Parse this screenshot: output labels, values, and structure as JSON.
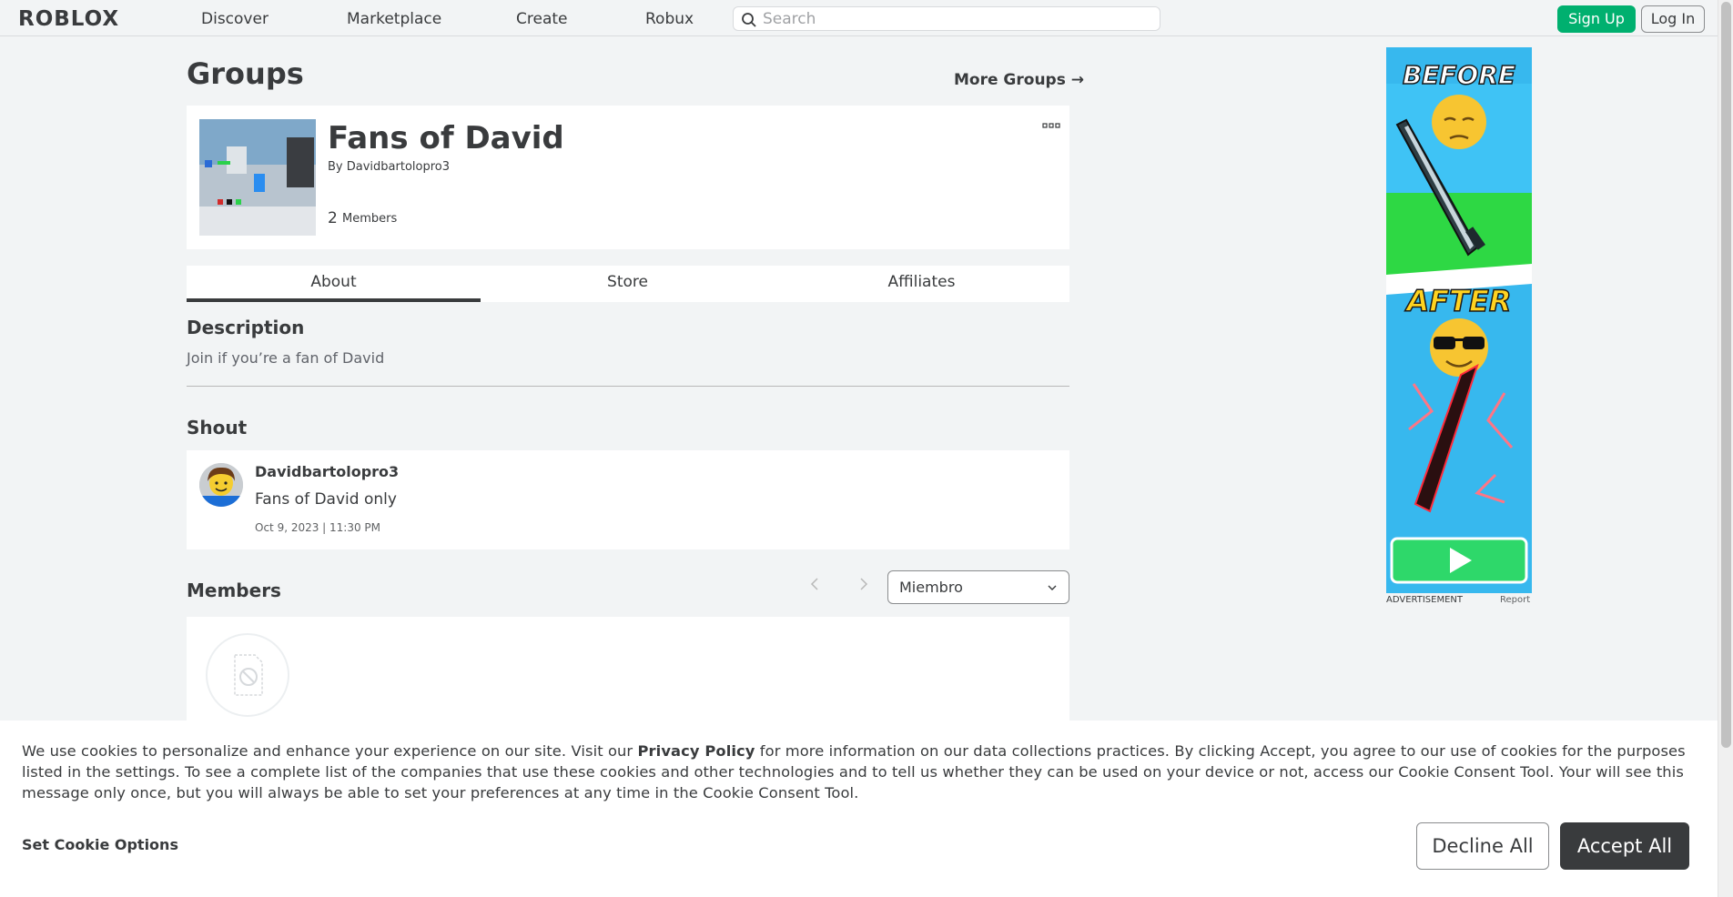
{
  "nav": {
    "logo": "ROBLOX",
    "items": [
      {
        "label": "Discover"
      },
      {
        "label": "Marketplace"
      },
      {
        "label": "Create"
      },
      {
        "label": "Robux"
      }
    ],
    "search_placeholder": "Search",
    "signup_label": "Sign Up",
    "login_label": "Log In"
  },
  "page": {
    "title": "Groups",
    "more_groups": "More Groups →"
  },
  "group": {
    "name": "Fans of David",
    "by_prefix": "By",
    "owner": "Davidbartolopro3",
    "member_count": "2",
    "members_label": "Members"
  },
  "tabs": [
    {
      "label": "About",
      "active": true
    },
    {
      "label": "Store",
      "active": false
    },
    {
      "label": "Affiliates",
      "active": false
    }
  ],
  "description": {
    "heading": "Description",
    "text": "Join if you’re a fan of David"
  },
  "shout": {
    "heading": "Shout",
    "user": "Davidbartolopro3",
    "message": "Fans of David only",
    "time": "Oct 9, 2023 | 11:30 PM"
  },
  "members": {
    "heading": "Members",
    "role_selected": "Miembro"
  },
  "ad": {
    "label": "ADVERTISEMENT",
    "report": "Report",
    "before_text": "BEFORE",
    "after_text": "AFTER"
  },
  "cookie": {
    "text_pre": "We use cookies to personalize and enhance your experience on our site. Visit our ",
    "privacy_link": "Privacy Policy",
    "text_post": " for more information on our data collections practices. By clicking Accept, you agree to our use of cookies for the purposes listed in the settings. To see a complete list of the companies that use these cookies and other technologies and to tell us whether they can be used on your device or not, access our Cookie Consent Tool. Your will see this message only once, but you will always be able to set your preferences at any time in the Cookie Consent Tool.",
    "set_options": "Set Cookie Options",
    "decline": "Decline All",
    "accept": "Accept All"
  },
  "colors": {
    "primary_green": "#00b06f",
    "text_dark": "#393b3d",
    "bg": "#f2f4f5"
  }
}
